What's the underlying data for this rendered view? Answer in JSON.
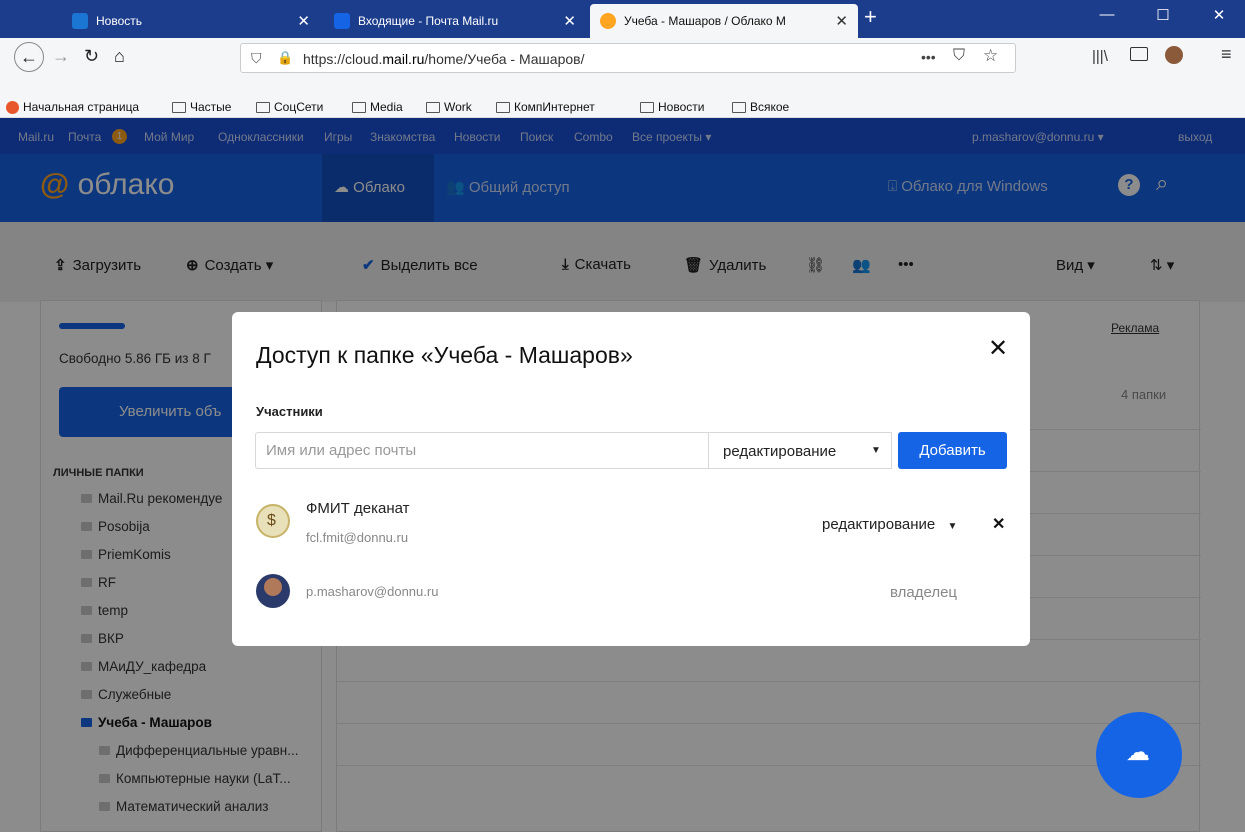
{
  "browser": {
    "tabs": [
      {
        "label": "Новость",
        "favicon_color": "#1a76d2"
      },
      {
        "label": "Входящие - Почта Mail.ru",
        "favicon_color": "#1664e6"
      },
      {
        "label": "Учеба - Машаров / Облако М",
        "favicon_color": "#ffa51f"
      }
    ],
    "url_prefix": "https://cloud.",
    "url_domain": "mail.ru",
    "url_path": "/home/Учеба - Машаров/",
    "bookmarks": [
      "Начальная страница",
      "Частые",
      "СоцСети",
      "Media",
      "Work",
      "КомпИнтернет",
      "Новости",
      "Всякое"
    ]
  },
  "portal": {
    "links": [
      "Mail.ru",
      "Почта",
      "Мой Мир",
      "Одноклассники",
      "Игры",
      "Знакомства",
      "Новости",
      "Поиск",
      "Combo",
      "Все проекты ▾"
    ],
    "mail_badge": "1",
    "user": "p.masharov@donnu.ru ▾",
    "logout": "выход"
  },
  "header": {
    "logo": "облако",
    "logo_at": "@",
    "nav_cloud": "Облако",
    "nav_shared": "Общий доступ",
    "windows": "Облако для Windows"
  },
  "toolbar": {
    "upload": "Загрузить",
    "create": "Создать ▾",
    "select_all": "Выделить все",
    "download": "Скачать",
    "delete": "Удалить",
    "view": "Вид ▾"
  },
  "sidebar": {
    "free_space": "Свободно 5.86 ГБ из 8 Г",
    "increase_button": "Увеличить объ",
    "section_title": "ЛИЧНЫЕ ПАПКИ",
    "folders": [
      "Mail.Ru рекомендуе",
      "Posobija",
      "PriemKomis",
      "RF",
      "temp",
      "ВКР",
      "МАиДУ_кафедра",
      "Служебные",
      "Учеба - Машаров",
      "Дифференциальные уравн...",
      "Компьютерные науки (LaT...",
      "Математический анализ"
    ]
  },
  "main": {
    "ad": "Реклама",
    "count": "4 папки"
  },
  "modal": {
    "title": "Доступ к папке «Учеба - Машаров»",
    "members_label": "Участники",
    "email_placeholder": "Имя или адрес почты",
    "permission": "редактирование",
    "add_button": "Добавить",
    "members": [
      {
        "name": "ФМИТ деканат",
        "email": "fcl.fmit@donnu.ru",
        "role": "редактирование"
      },
      {
        "name": "",
        "email": "p.masharov@donnu.ru",
        "role": "владелец"
      }
    ]
  },
  "colors": {
    "brand_blue": "#1664e6",
    "accent_orange": "#ffa51f"
  }
}
